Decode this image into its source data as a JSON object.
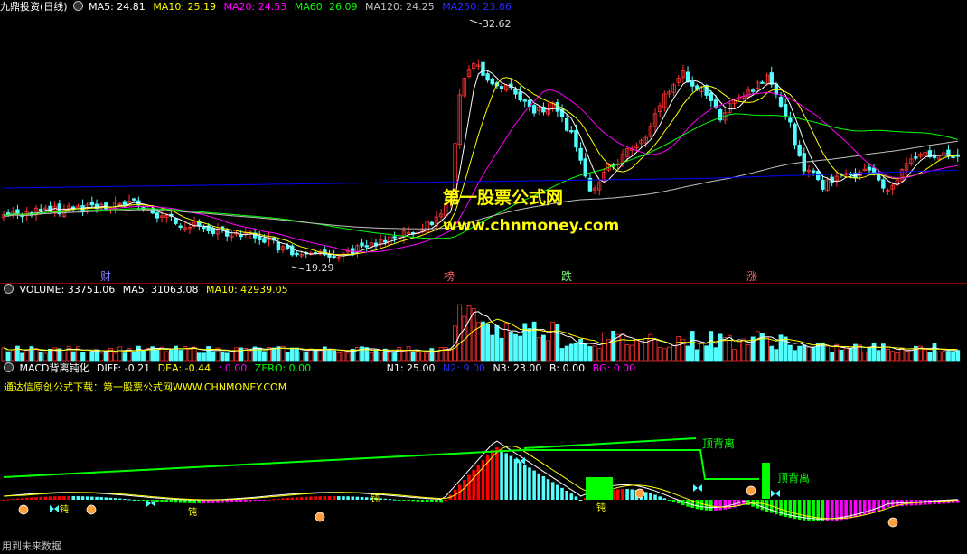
{
  "colors": {
    "up": "#ff3232",
    "down": "#54ffff",
    "ma5": "#ffffff",
    "ma10": "#ffff00",
    "ma20": "#ff00ff",
    "ma60": "#00ff00",
    "ma120": "#c0c0c0",
    "ma250": "#0000ff",
    "macd_red": "#ff0000",
    "macd_cyan": "#54ffff",
    "macd_green": "#00ff00",
    "macd_magenta": "#ff00ff",
    "signal_line": "#00ff00"
  },
  "price": {
    "title": "九鼎投资(日线)",
    "ma_labels": [
      {
        "text": "MA5: 24.81",
        "color": "#ffffff"
      },
      {
        "text": "MA10: 25.19",
        "color": "#ffff00"
      },
      {
        "text": "MA20: 24.53",
        "color": "#ff00ff"
      },
      {
        "text": "MA60: 26.09",
        "color": "#00ff00"
      },
      {
        "text": "MA120: 24.25",
        "color": "#c0c0c0"
      },
      {
        "text": "MA250: 23.86",
        "color": "#0000ff"
      }
    ],
    "high_label": "32.62",
    "low_label": "19.29",
    "events": [
      {
        "text": "财",
        "color": "#8080ff"
      },
      {
        "text": "榜",
        "color": "#ff6060"
      },
      {
        "text": "跌",
        "color": "#80ff80"
      },
      {
        "text": "涨",
        "color": "#ff6060"
      }
    ],
    "watermark_cn": "第一股票公式网",
    "watermark_url": "www.chnmoney.com"
  },
  "volume": {
    "labels": [
      {
        "text": "VOLUME: 33751.06",
        "color": "#ffffff"
      },
      {
        "text": "MA5: 31063.08",
        "color": "#ffffff"
      },
      {
        "text": "MA10: 42939.05",
        "color": "#ffff00"
      }
    ]
  },
  "macd": {
    "title": "MACD背离钝化",
    "labels": [
      {
        "text": "DIFF: -0.21",
        "color": "#ffffff"
      },
      {
        "text": "DEA: -0.44",
        "color": "#ffff00"
      },
      {
        "text": ": 0.00",
        "color": "#ff00ff"
      },
      {
        "text": "ZERO: 0.00",
        "color": "#00ff00"
      },
      {
        "text": "N1: 25.00",
        "color": "#ffffff"
      },
      {
        "text": "N2: 9.00",
        "color": "#0000ff"
      },
      {
        "text": "N3: 23.00",
        "color": "#ffffff"
      },
      {
        "text": "B: 0.00",
        "color": "#ffffff"
      },
      {
        "text": "BG: 0.00",
        "color": "#ff00ff"
      }
    ],
    "subtitle": "通达信原创公式下载：第一股票公式网WWW.CHNMONEY.COM",
    "annotations": [
      "顶背离",
      "顶背离"
    ],
    "marks": [
      "钝",
      "钝",
      "钝",
      "钝"
    ]
  },
  "status": {
    "text": "用到未来数据"
  }
}
